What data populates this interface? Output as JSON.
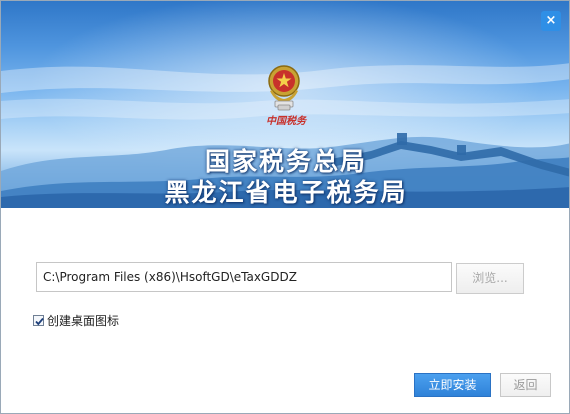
{
  "window": {
    "close_icon": "close-icon",
    "close_glyph": "×"
  },
  "banner": {
    "calligraphy": "中国税务",
    "title_line1": "国家税务总局",
    "title_line2": "黑龙江省电子税务局",
    "emblem_icon": "tax-emblem-icon"
  },
  "install": {
    "path_value": "C:\\Program Files (x86)\\HsoftGD\\eTaxGDDZ",
    "browse_label": "浏览...",
    "desktop_shortcut_label": "创建桌面图标",
    "desktop_shortcut_checked": true,
    "install_label": "立即安装",
    "back_label": "返回"
  },
  "colors": {
    "accent": "#2f82d8",
    "close_bg": "#2f8fe6"
  }
}
